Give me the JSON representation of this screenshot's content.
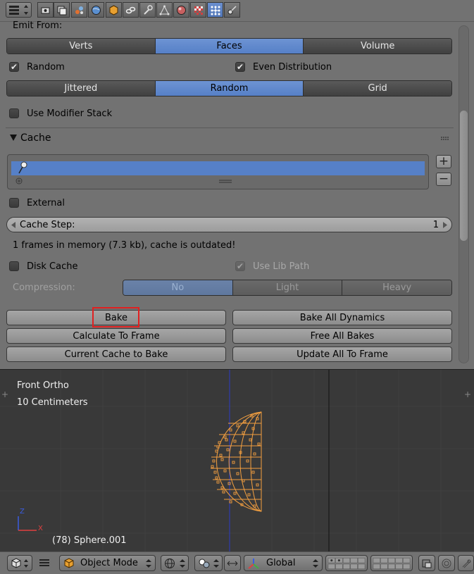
{
  "top_header": {
    "editor_icon": "properties-editor-icon",
    "context_tabs": [
      {
        "name": "render-icon",
        "active": false
      },
      {
        "name": "render-layers-icon",
        "active": false
      },
      {
        "name": "scene-icon",
        "active": false
      },
      {
        "name": "world-icon",
        "active": false
      },
      {
        "name": "object-icon",
        "active": false
      },
      {
        "name": "constraints-icon",
        "active": false
      },
      {
        "name": "modifiers-icon",
        "active": false
      },
      {
        "name": "data-icon",
        "active": false
      },
      {
        "name": "material-icon",
        "active": false
      },
      {
        "name": "texture-icon",
        "active": false
      },
      {
        "name": "particles-icon",
        "active": true
      },
      {
        "name": "physics-icon",
        "active": false
      }
    ]
  },
  "emission": {
    "emit_from_label": "Emit From:",
    "emit_from_options": [
      "Verts",
      "Faces",
      "Volume"
    ],
    "emit_from_selected": "Faces",
    "random_label": "Random",
    "random_checked": true,
    "even_distribution_label": "Even Distribution",
    "even_distribution_checked": true,
    "distribution_options": [
      "Jittered",
      "Random",
      "Grid"
    ],
    "distribution_selected": "Random",
    "use_modifier_stack_label": "Use Modifier Stack",
    "use_modifier_stack_checked": false
  },
  "cache": {
    "title": "Cache",
    "external_label": "External",
    "external_checked": false,
    "cache_step_label": "Cache Step:",
    "cache_step_value": "1",
    "status_text": "1 frames in memory (7.3 kb), cache is outdated!",
    "disk_cache_label": "Disk Cache",
    "disk_cache_checked": false,
    "use_lib_path_label": "Use Lib Path",
    "use_lib_path_checked": true,
    "compression_label": "Compression:",
    "compression_options": [
      "No",
      "Light",
      "Heavy"
    ],
    "compression_selected": "No",
    "buttons": {
      "bake": "Bake",
      "bake_all_dynamics": "Bake All Dynamics",
      "calculate_to_frame": "Calculate To Frame",
      "free_all_bakes": "Free All Bakes",
      "current_cache_to_bake": "Current Cache to Bake",
      "update_all_to_frame": "Update All To Frame"
    },
    "highlight_color": "#e02020"
  },
  "viewport": {
    "view_name": "Front Ortho",
    "grid_scale": "10 Centimeters",
    "object_info": "(78) Sphere.001",
    "axis_z": "Z",
    "axis_x": "X",
    "mesh_color": "#f5a040"
  },
  "bottom_bar": {
    "mode_label": "Object Mode",
    "orientation_label": "Global"
  },
  "colors": {
    "accent_blue": "#5680c7",
    "panel_bg": "#727272",
    "viewport_bg": "#393939"
  }
}
